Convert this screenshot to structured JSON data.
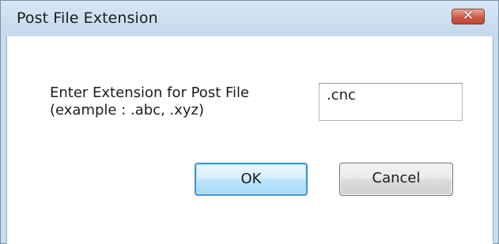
{
  "window": {
    "title": "Post File Extension",
    "close_glyph": "✕"
  },
  "form": {
    "prompt_line1": "Enter Extension for Post File",
    "prompt_line2": "(example : .abc, .xyz)",
    "extension_value": ".cnc"
  },
  "buttons": {
    "ok_label": "OK",
    "cancel_label": "Cancel"
  },
  "colors": {
    "title_bar": "#c9dced",
    "close_button": "#c75a46",
    "ok_border": "#3d94d6"
  },
  "icons": {
    "close": "close-icon"
  }
}
